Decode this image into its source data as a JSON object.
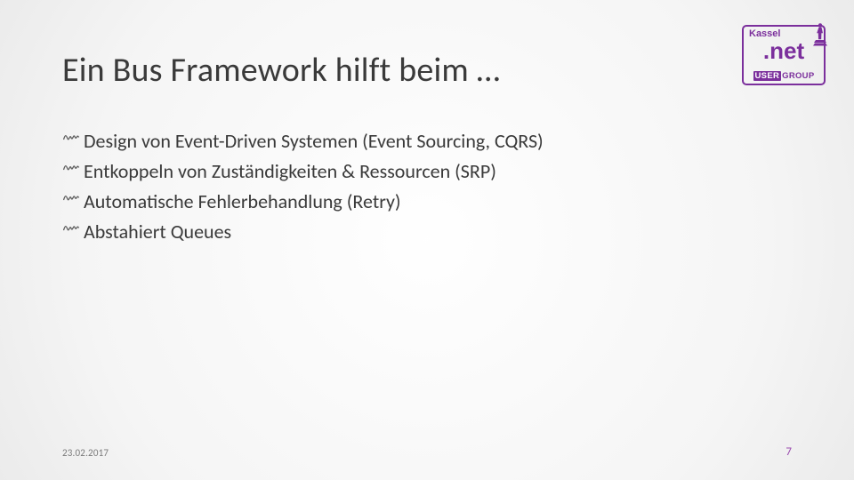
{
  "title": "Ein Bus Framework hilft beim …",
  "bullets": [
    "Design von Event-Driven Systemen (Event Sourcing, CQRS)",
    "Entkoppeln von Zuständigkeiten & Ressourcen (SRP)",
    "Automatische Fehlerbehandlung (Retry)",
    "Abstahiert Queues"
  ],
  "footer": {
    "date": "23.02.2017",
    "page": "7"
  },
  "logo": {
    "city": "Kassel",
    "main": ".net",
    "sub_user": "USER",
    "sub_group": "GROUP"
  }
}
